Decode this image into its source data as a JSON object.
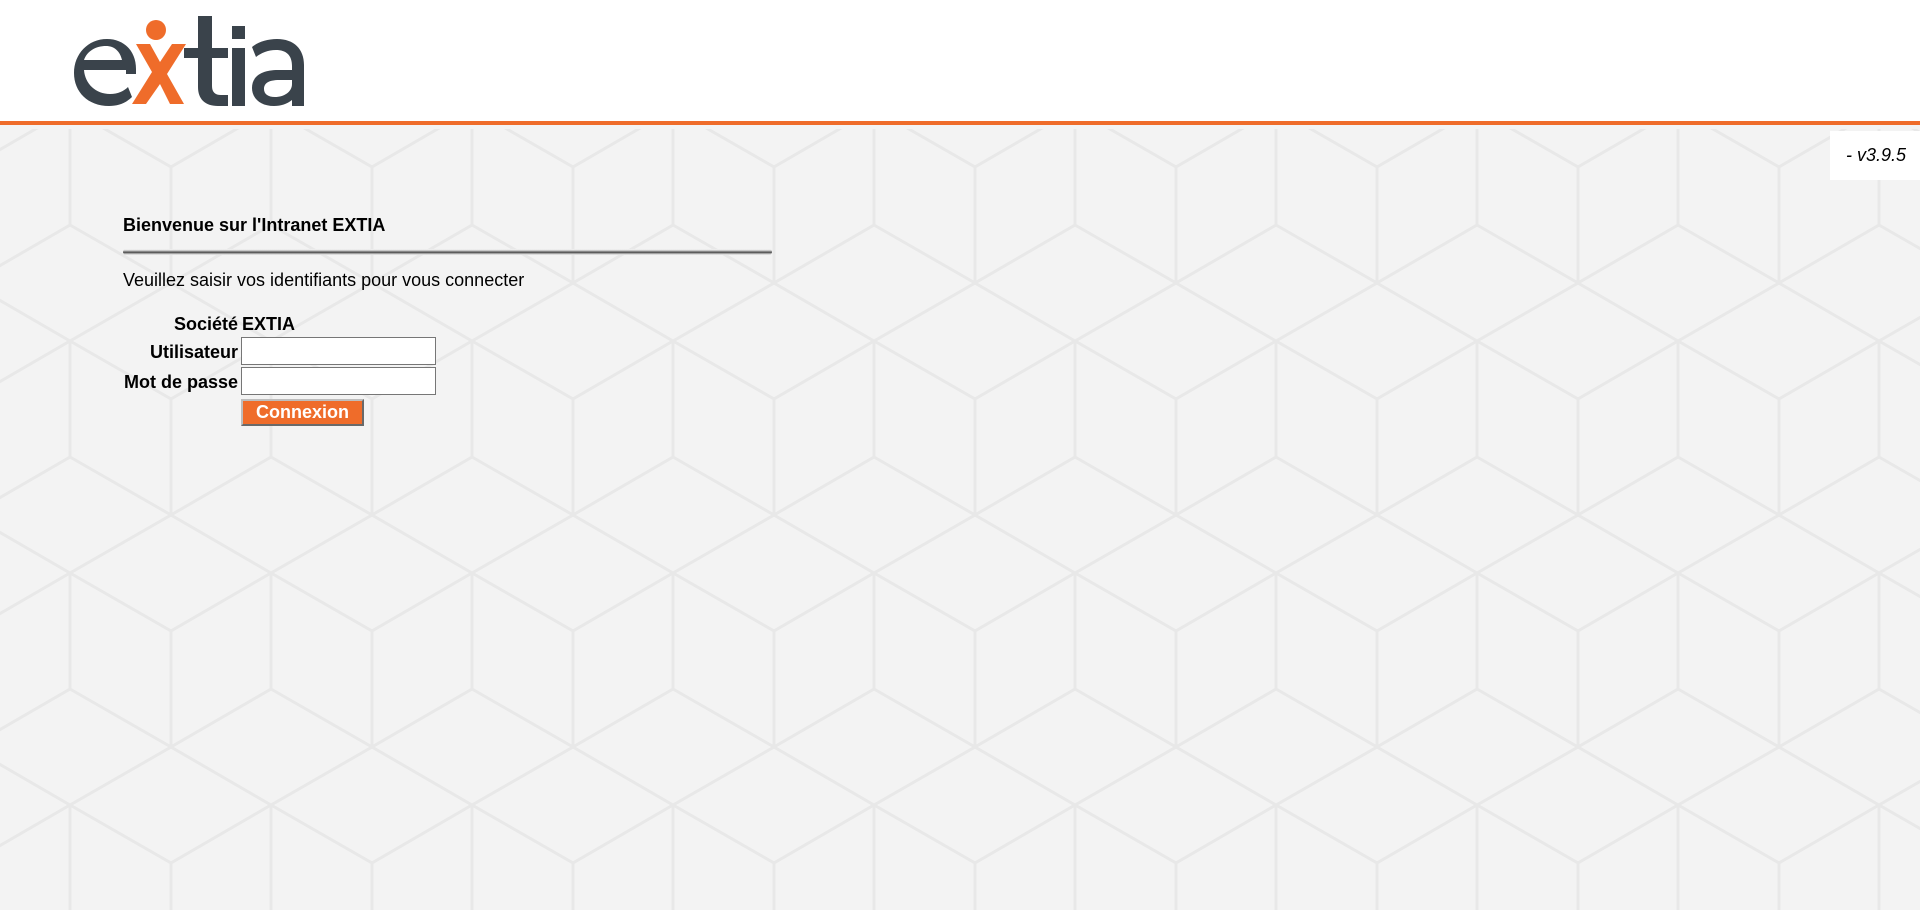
{
  "brand": {
    "logo_text": "extia",
    "colors": {
      "accent": "#ef6c2a",
      "dark": "#3a434b",
      "background": "#f3f3f3"
    }
  },
  "version": "- v3.9.5",
  "login": {
    "welcome": "Bienvenue sur l'Intranet EXTIA",
    "instructions": "Veuillez saisir vos identifiants pour vous connecter",
    "company_label": "Société",
    "company_value": "EXTIA",
    "user_label": "Utilisateur",
    "user_value": "",
    "password_label": "Mot de passe",
    "password_value": "",
    "submit_label": "Connexion"
  }
}
